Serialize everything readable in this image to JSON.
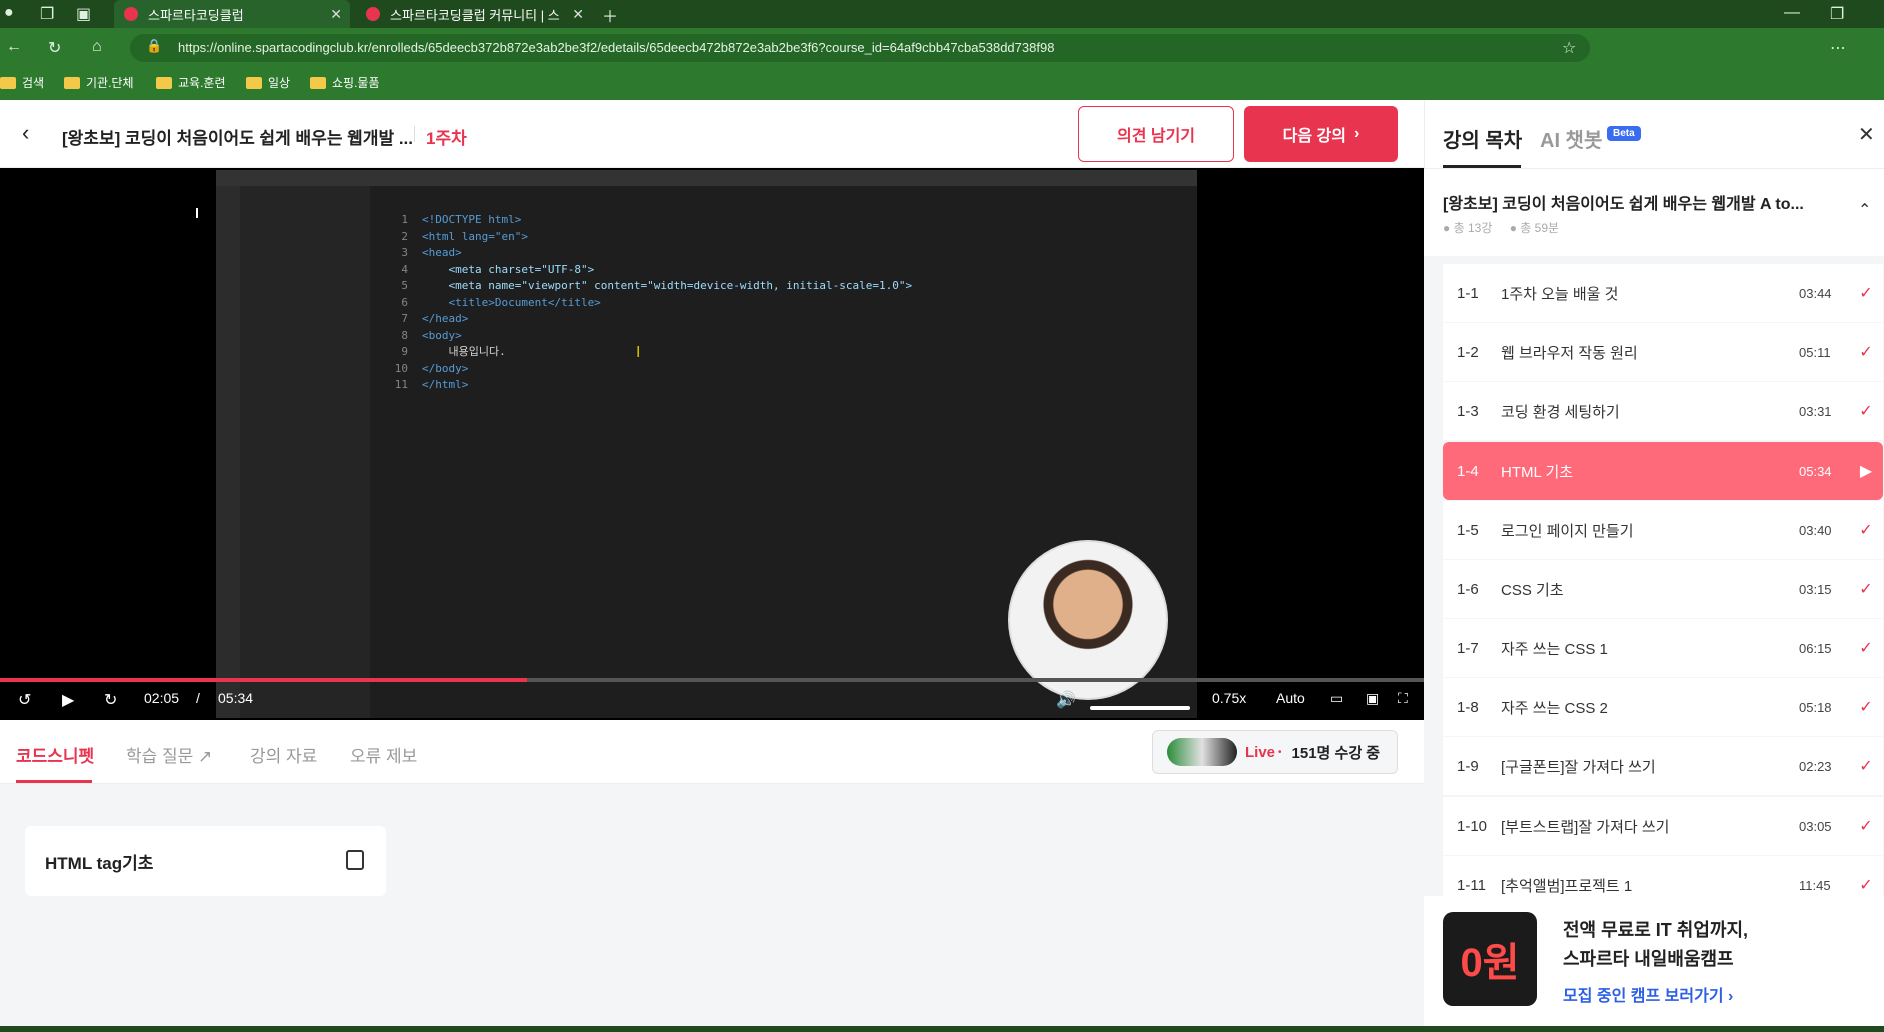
{
  "browser": {
    "tabs": [
      {
        "label": "스파르타코딩클럽"
      },
      {
        "label": "스파르타코딩클럽 커뮤니티 | 스"
      }
    ],
    "url": "https://online.spartacodingclub.kr/enrolleds/65deecb372b872e3ab2be3f2/edetails/65deecb472b872e3ab2be3f6?course_id=64af9cbb47cba538dd738f98",
    "bookmarks": [
      "검색",
      "기관.단체",
      "교육.훈련",
      "일상",
      "쇼핑.물품"
    ]
  },
  "header": {
    "title": "[왕초보] 코딩이 처음이어도 쉽게 배우는 웹개발 ...",
    "week": "1주차",
    "feedback_label": "의견 남기기",
    "next_label": "다음 강의"
  },
  "player": {
    "current_time": "02:05",
    "separator": "/",
    "duration": "05:34",
    "speed": "0.75x",
    "quality": "Auto",
    "progress": 0.37,
    "code_lines": [
      "<!DOCTYPE html>",
      "<html lang=\"en\">",
      "<head>",
      "    <meta charset=\"UTF-8\">",
      "    <meta name=\"viewport\" content=\"width=device-width, initial-scale=1.0\">",
      "    <title>Document</title>",
      "</head>",
      "<body>",
      "    내용입니다.",
      "</body>",
      "</html>"
    ]
  },
  "subtabs": [
    "코드스니펫",
    "학습 질문",
    "강의 자료",
    "오류 제보"
  ],
  "live": {
    "label": "Live",
    "count_text": "151명 수강 중"
  },
  "snippet": {
    "label": "HTML tag기초"
  },
  "sidebar": {
    "tab_toc": "강의 목차",
    "tab_ai": "AI 챗봇",
    "beta": "Beta",
    "course_title": "[왕초보] 코딩이 처음이어도 쉽게 배우는 웹개발 A to...",
    "total_lessons": "총 13강",
    "total_time": "총 59분",
    "lessons": [
      {
        "num": "1-1",
        "name": "1주차 오늘 배울 것",
        "time": "03:44"
      },
      {
        "num": "1-2",
        "name": "웹 브라우저 작동 원리",
        "time": "05:11"
      },
      {
        "num": "1-3",
        "name": "코딩 환경 세팅하기",
        "time": "03:31"
      },
      {
        "num": "1-4",
        "name": "HTML 기초",
        "time": "05:34"
      },
      {
        "num": "1-5",
        "name": "로그인 페이지 만들기",
        "time": "03:40"
      },
      {
        "num": "1-6",
        "name": "CSS 기초",
        "time": "03:15"
      },
      {
        "num": "1-7",
        "name": "자주 쓰는 CSS 1",
        "time": "06:15"
      },
      {
        "num": "1-8",
        "name": "자주 쓰는 CSS 2",
        "time": "05:18"
      },
      {
        "num": "1-9",
        "name": "[구글폰트]잘 가져다 쓰기",
        "time": "02:23"
      },
      {
        "num": "1-10",
        "name": "[부트스트랩]잘 가져다 쓰기",
        "time": "03:05"
      },
      {
        "num": "1-11",
        "name": "[추억앨범]프로젝트 1",
        "time": "11:45"
      }
    ],
    "promo": {
      "badge": "0원",
      "line1": "전액 무료로 IT 취업까지,",
      "line2": "스파르타 내일배움캠프",
      "link": "모집 중인 캠프 보러가기"
    }
  }
}
